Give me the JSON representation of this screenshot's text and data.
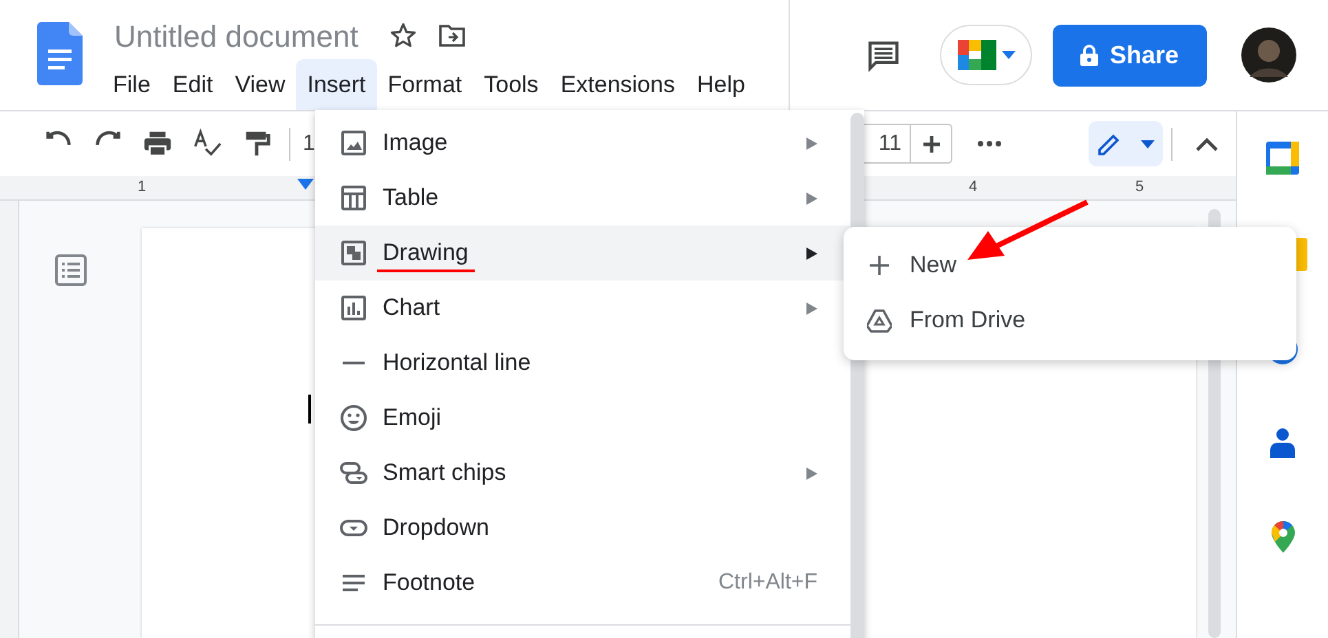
{
  "document": {
    "title": "Untitled document",
    "text_cursor": true
  },
  "menu_bar": [
    {
      "label": "File",
      "selected": false
    },
    {
      "label": "Edit",
      "selected": false
    },
    {
      "label": "View",
      "selected": false
    },
    {
      "label": "Insert",
      "selected": true
    },
    {
      "label": "Format",
      "selected": false
    },
    {
      "label": "Tools",
      "selected": false
    },
    {
      "label": "Extensions",
      "selected": false
    },
    {
      "label": "Help",
      "selected": false
    }
  ],
  "share_button": {
    "label": "Share"
  },
  "toolbar": {
    "zoom_partial": "1",
    "font_size": "11"
  },
  "ruler": {
    "labels": [
      "1",
      "4",
      "5"
    ]
  },
  "insert_menu": {
    "items": [
      {
        "label": "Image",
        "kind": "submenu",
        "selected": false
      },
      {
        "label": "Table",
        "kind": "submenu",
        "selected": false
      },
      {
        "label": "Drawing",
        "kind": "submenu",
        "selected": true
      },
      {
        "label": "Chart",
        "kind": "submenu",
        "selected": false
      },
      {
        "label": "Horizontal line",
        "kind": "plain",
        "selected": false
      },
      {
        "label": "Emoji",
        "kind": "plain",
        "selected": false
      },
      {
        "label": "Smart chips",
        "kind": "submenu",
        "selected": false
      },
      {
        "label": "Dropdown",
        "kind": "plain",
        "selected": false
      },
      {
        "label": "Footnote",
        "kind": "shortcut",
        "shortcut": "Ctrl+Alt+F",
        "selected": false
      }
    ]
  },
  "drawing_submenu": {
    "items": [
      {
        "label": "New"
      },
      {
        "label": "From Drive"
      }
    ]
  }
}
